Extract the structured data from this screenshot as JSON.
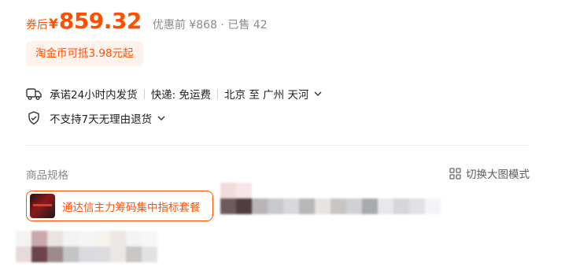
{
  "price": {
    "prefix": "券后",
    "currency": "¥",
    "amount": "859.32",
    "meta": "优惠前 ¥868 · 已售 42",
    "accent_color": "#ff5000"
  },
  "coin_tag": "淘金币可抵3.98元起",
  "shipping": {
    "icon": "truck-icon",
    "promise": "承诺24小时内发货",
    "delivery": "快递: 免运费",
    "route": "北京 至 广州 天河"
  },
  "returns": {
    "icon": "shield-hand-icon",
    "text": "不支持7天无理由退货"
  },
  "specs": {
    "title": "商品规格",
    "switch_label": "切换大图模式",
    "switch_icon": "grid-icon",
    "selected_sku": "通达信主力筹码集中指标套餐"
  }
}
